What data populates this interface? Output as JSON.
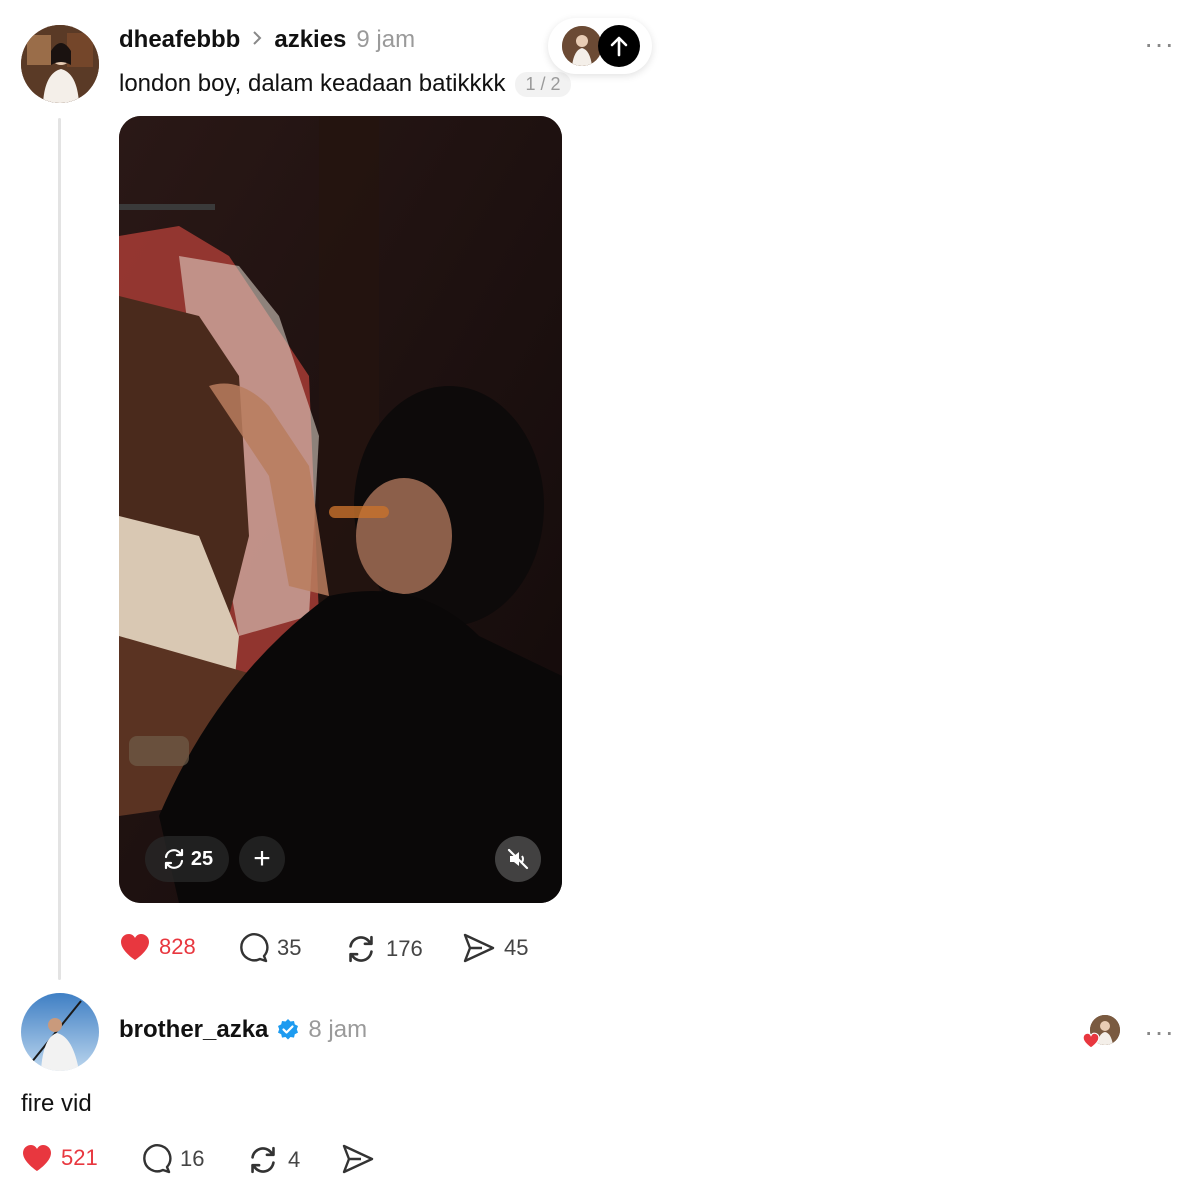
{
  "post": {
    "author": "dheafebbb",
    "replying_to": "azkies",
    "time": "9 jam",
    "caption": "london boy, dalam keadaan batikkkk",
    "pager": "1 / 2",
    "more_label": "···",
    "video": {
      "repost_count": "25",
      "add_label": "+",
      "mute_icon": "mute-icon"
    },
    "actions": {
      "likes": "828",
      "comments": "35",
      "reposts": "176",
      "shares": "45"
    }
  },
  "reply": {
    "author": "brother_azka",
    "verified": true,
    "time": "8 jam",
    "text": "fire vid",
    "more_label": "···",
    "actions": {
      "likes": "521",
      "comments": "16",
      "reposts": "4"
    }
  },
  "colors": {
    "like_red": "#e8373f",
    "verified_blue": "#1d9bf0",
    "muted_gray": "#9a9a9a"
  }
}
